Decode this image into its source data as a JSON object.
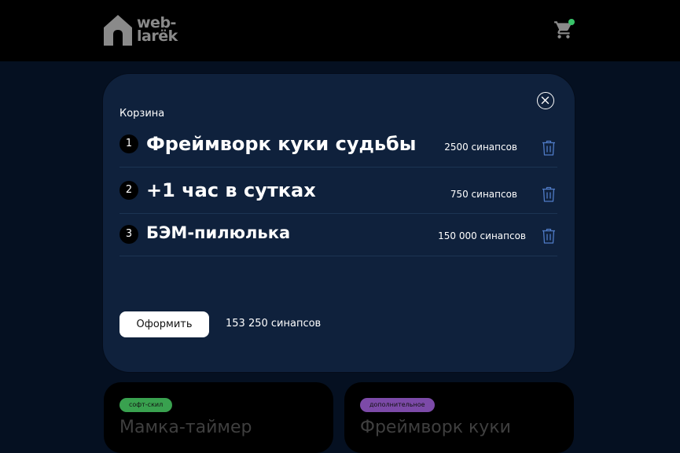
{
  "header": {
    "logo_line1": "web-",
    "logo_line2": "larëk",
    "cart_badge_color": "#39c46a"
  },
  "background_cards": [
    {
      "tag": "софт-скил",
      "tag_color": "#39a14f",
      "title": "Мамка-таймер"
    },
    {
      "tag": "дополнительное",
      "tag_color": "#7c4aa8",
      "title": "Фреймворк куки"
    }
  ],
  "basket": {
    "title": "Корзина",
    "items": [
      {
        "index": "1",
        "title": "Фреймворк куки судьбы",
        "price": "2500 синапсов"
      },
      {
        "index": "2",
        "title": "+1 час в сутках",
        "price": "750 синапсов"
      },
      {
        "index": "3",
        "title": "БЭМ-пилюлька",
        "price": "150 000 синапсов"
      }
    ],
    "order_button": "Оформить",
    "total": "153 250 синапсов"
  }
}
